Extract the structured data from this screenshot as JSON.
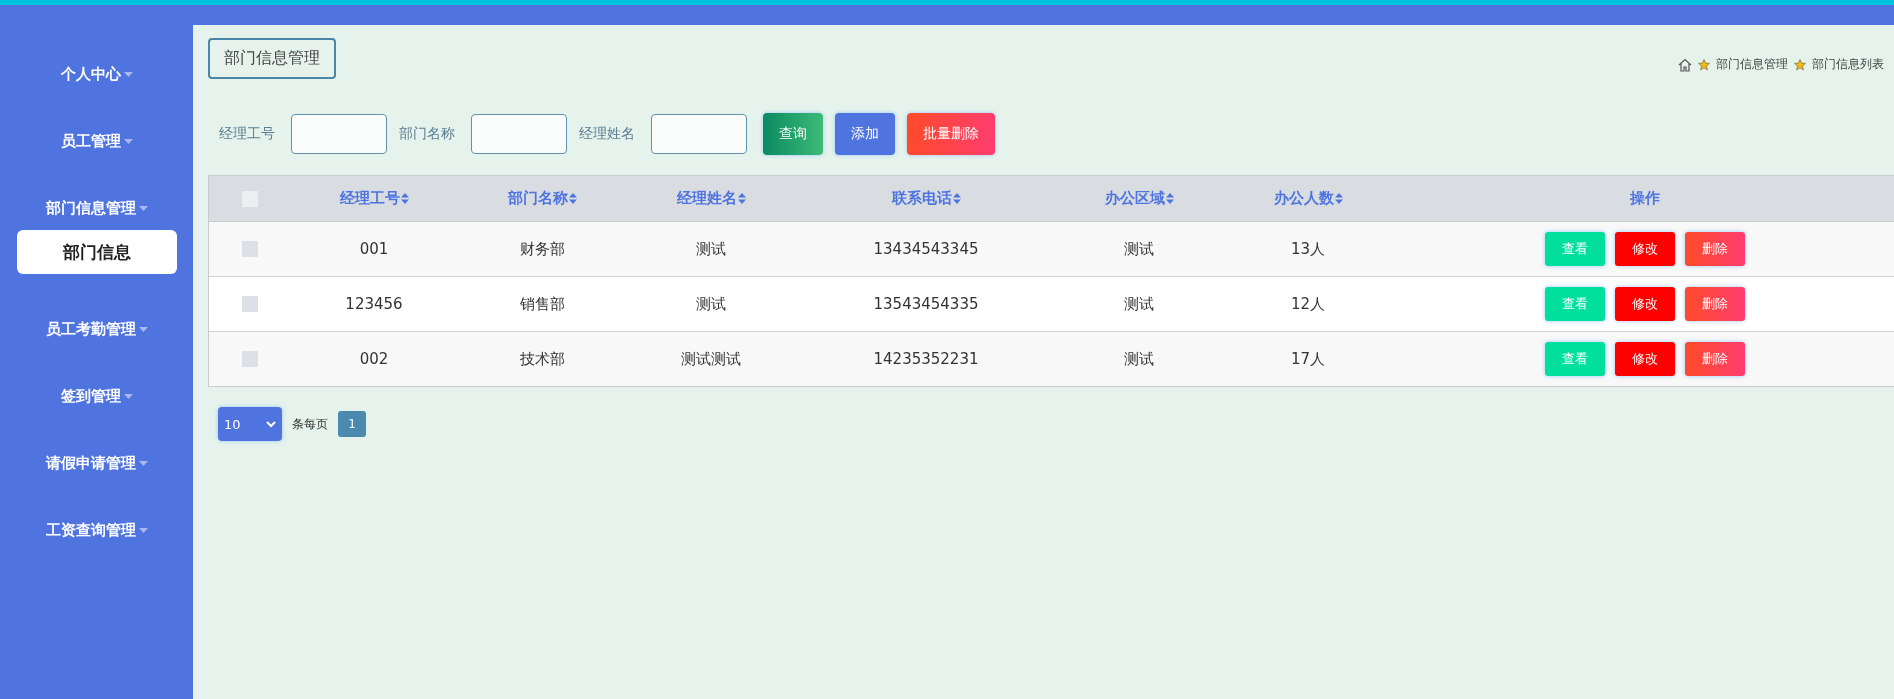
{
  "sidebar": {
    "items": [
      {
        "label": "个人中心"
      },
      {
        "label": "员工管理"
      },
      {
        "label": "部门信息管理",
        "children": [
          {
            "label": "部门信息",
            "selected": true
          }
        ]
      },
      {
        "label": "员工考勤管理"
      },
      {
        "label": "签到管理"
      },
      {
        "label": "请假申请管理"
      },
      {
        "label": "工资查询管理"
      }
    ]
  },
  "page_title": "部门信息管理",
  "breadcrumb": [
    "部门信息管理",
    "部门信息列表"
  ],
  "search": {
    "fields": [
      {
        "label": "经理工号"
      },
      {
        "label": "部门名称"
      },
      {
        "label": "经理姓名"
      }
    ],
    "buttons": [
      {
        "label": "查询",
        "kind": "query"
      },
      {
        "label": "添加",
        "kind": "add"
      },
      {
        "label": "批量删除",
        "kind": "bulk-delete"
      }
    ]
  },
  "table": {
    "select_all_checked": false,
    "columns": [
      "经理工号",
      "部门名称",
      "经理姓名",
      "联系电话",
      "办公区域",
      "办公人数",
      "操作"
    ],
    "rows": [
      {
        "checked": false,
        "cells": [
          "001",
          "财务部",
          "测试",
          "13434543345",
          "测试",
          "13人"
        ],
        "actions": [
          {
            "label": "查看",
            "kind": "view"
          },
          {
            "label": "修改",
            "kind": "edit"
          },
          {
            "label": "删除",
            "kind": "delete"
          }
        ]
      },
      {
        "checked": false,
        "cells": [
          "123456",
          "销售部",
          "测试",
          "13543454335",
          "测试",
          "12人"
        ],
        "actions": [
          {
            "label": "查看",
            "kind": "view"
          },
          {
            "label": "修改",
            "kind": "edit"
          },
          {
            "label": "删除",
            "kind": "delete"
          }
        ]
      },
      {
        "checked": false,
        "cells": [
          "002",
          "技术部",
          "测试测试",
          "14235352231",
          "测试",
          "17人"
        ],
        "actions": [
          {
            "label": "查看",
            "kind": "view"
          },
          {
            "label": "修改",
            "kind": "edit"
          },
          {
            "label": "删除",
            "kind": "delete"
          }
        ]
      }
    ]
  },
  "pagination": {
    "page_size": "10",
    "per_page_label": "条每页",
    "pages": [
      {
        "label": "1",
        "selected": true
      }
    ]
  }
}
